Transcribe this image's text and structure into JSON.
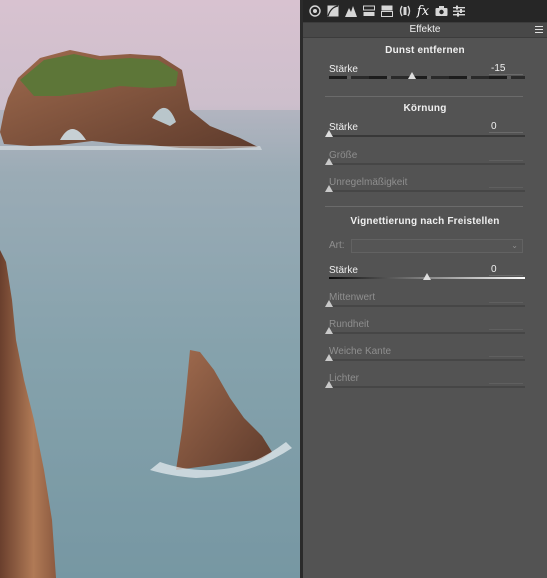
{
  "toolbar": {
    "icons": [
      "basic-aperture-icon",
      "tone-curve-icon",
      "detail-icon",
      "hsl-icon",
      "split-toning-icon",
      "lens-corrections-icon",
      "effects-fx-icon",
      "camera-calibration-icon",
      "presets-icon"
    ],
    "fx_label": "fx",
    "active": "effects-fx-icon"
  },
  "panel": {
    "title": "Effekte",
    "dehaze": {
      "title": "Dunst entfernen",
      "amount": {
        "label": "Stärke",
        "value": "-15",
        "level": -15,
        "min": -100,
        "max": 100
      }
    },
    "grain": {
      "title": "Körnung",
      "amount": {
        "label": "Stärke",
        "value": "0",
        "level": 0,
        "min": 0,
        "max": 100
      },
      "size": {
        "label": "Größe",
        "value": "",
        "level": 0
      },
      "roughness": {
        "label": "Unregelmäßigkeit",
        "value": "",
        "level": 0
      }
    },
    "vignette": {
      "title": "Vignettierung nach Freistellen",
      "style": {
        "label": "Art:",
        "value": ""
      },
      "amount": {
        "label": "Stärke",
        "value": "0",
        "level": 0,
        "min": -100,
        "max": 100
      },
      "midpoint": {
        "label": "Mittenwert",
        "value": "",
        "level": 0
      },
      "roundness": {
        "label": "Rundheit",
        "value": "",
        "level": 0
      },
      "feather": {
        "label": "Weiche Kante",
        "value": "",
        "level": 0
      },
      "highlights": {
        "label": "Lichter",
        "value": "",
        "level": 0
      }
    }
  },
  "colors": {
    "panel_bg": "#535353",
    "toolbar_bg": "#262626",
    "sky": "#d6c4cf",
    "sea": "#7f9ea8",
    "rock": "#8a5a43",
    "moss": "#5f7a3a"
  }
}
